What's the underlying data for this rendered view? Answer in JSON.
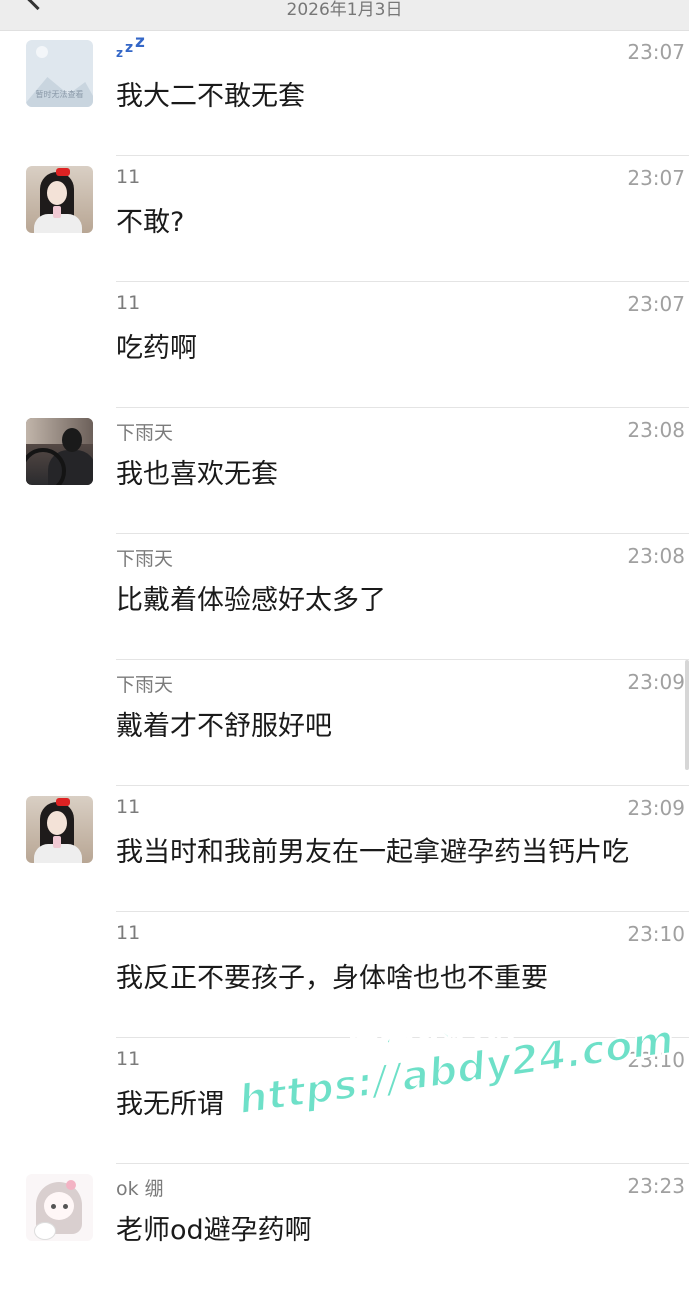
{
  "header": {
    "date": "2026年1月3日"
  },
  "messages": [
    {
      "avatar": "placeholder",
      "avatar_caption": "暂时无法查看",
      "name": "",
      "name_icon": "zzz-icon",
      "time": "23:07",
      "text": "我大二不敢无套"
    },
    {
      "avatar": "girl-selfie",
      "name": "11",
      "time": "23:07",
      "text": "不敢?"
    },
    {
      "avatar": "",
      "name": "11",
      "time": "23:07",
      "text": "吃药啊"
    },
    {
      "avatar": "man-in-car",
      "name": "下雨天",
      "time": "23:08",
      "text": "我也喜欢无套"
    },
    {
      "avatar": "",
      "name": "下雨天",
      "time": "23:08",
      "text": "比戴着体验感好太多了"
    },
    {
      "avatar": "",
      "name": "下雨天",
      "time": "23:09",
      "text": "戴着才不舒服好吧"
    },
    {
      "avatar": "girl-selfie",
      "name": "11",
      "time": "23:09",
      "text": "我当时和我前男友在一起拿避孕药当钙片吃"
    },
    {
      "avatar": "",
      "name": "11",
      "time": "23:10",
      "text": "我反正不要孩子，身体啥也也不重要"
    },
    {
      "avatar": "",
      "name": "11",
      "time": "23:10",
      "text": "我无所谓"
    },
    {
      "avatar": "anime-girl-cat",
      "name": "ok 绷",
      "time": "23:23",
      "text": "老师od避孕药啊"
    }
  ],
  "watermark": {
    "line1": "黑料不打烊",
    "line2": "https://abdy24.com"
  }
}
